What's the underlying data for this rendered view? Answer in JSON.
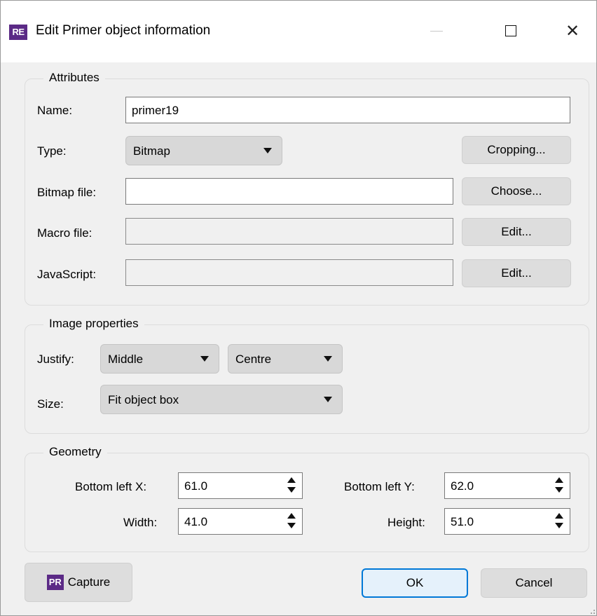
{
  "window": {
    "app_icon": "RE",
    "title": "Edit Primer object information",
    "icons": {
      "app": "re-app-icon",
      "minimize": "minimize-icon",
      "maximize": "maximize-icon",
      "close": "close-icon"
    },
    "close_glyph": "✕"
  },
  "attributes": {
    "title": "Attributes",
    "name_label": "Name:",
    "name_value": "primer19",
    "type_label": "Type:",
    "type_value": "Bitmap",
    "cropping_button": "Cropping...",
    "bitmap_file_label": "Bitmap file:",
    "bitmap_file_value": "",
    "choose_button": "Choose...",
    "macro_file_label": "Macro file:",
    "macro_file_value": "",
    "macro_edit_button": "Edit...",
    "javascript_label": "JavaScript:",
    "javascript_value": "",
    "javascript_edit_button": "Edit..."
  },
  "image_properties": {
    "title": "Image properties",
    "justify_label": "Justify:",
    "justify_vertical": "Middle",
    "justify_horizontal": "Centre",
    "size_label": "Size:",
    "size_value": "Fit object box"
  },
  "geometry": {
    "title": "Geometry",
    "bottom_left_x_label": "Bottom left X:",
    "bottom_left_x": "61.0",
    "bottom_left_y_label": "Bottom left Y:",
    "bottom_left_y": "62.0",
    "width_label": "Width:",
    "width": "41.0",
    "height_label": "Height:",
    "height": "51.0"
  },
  "footer": {
    "capture_icon": "PR",
    "capture_button": "Capture",
    "ok_button": "OK",
    "cancel_button": "Cancel"
  },
  "colors": {
    "accent": "#0078d7",
    "brand": "#5b2a86",
    "background": "#f0f0f0"
  }
}
